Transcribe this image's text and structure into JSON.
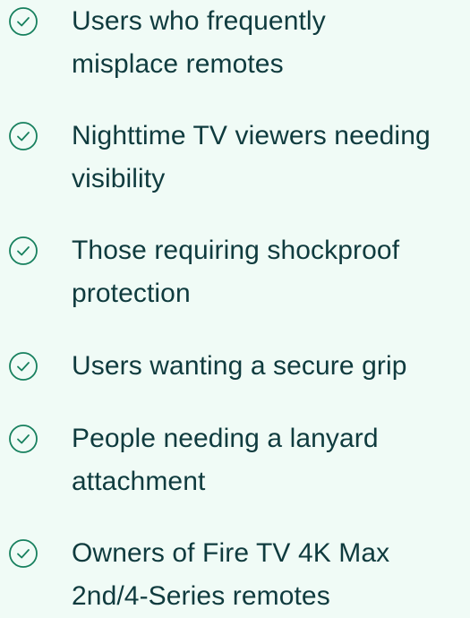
{
  "colors": {
    "background": "#f0fbf6",
    "text": "#0f3b3e",
    "check_icon": "#17805e"
  },
  "items": [
    {
      "icon": "check-circle-icon",
      "line1": "Users who frequently",
      "line2": "misplace remotes"
    },
    {
      "icon": "check-circle-icon",
      "line1": "Nighttime TV viewers needing",
      "line2": "visibility"
    },
    {
      "icon": "check-circle-icon",
      "line1": "Those requiring shockproof",
      "line2": "protection"
    },
    {
      "icon": "check-circle-icon",
      "line1": "Users wanting a secure grip",
      "line2": ""
    },
    {
      "icon": "check-circle-icon",
      "line1": "People needing a lanyard",
      "line2": "attachment"
    },
    {
      "icon": "check-circle-icon",
      "line1": "Owners of Fire TV 4K Max",
      "line2": "2nd/4-Series remotes"
    }
  ]
}
